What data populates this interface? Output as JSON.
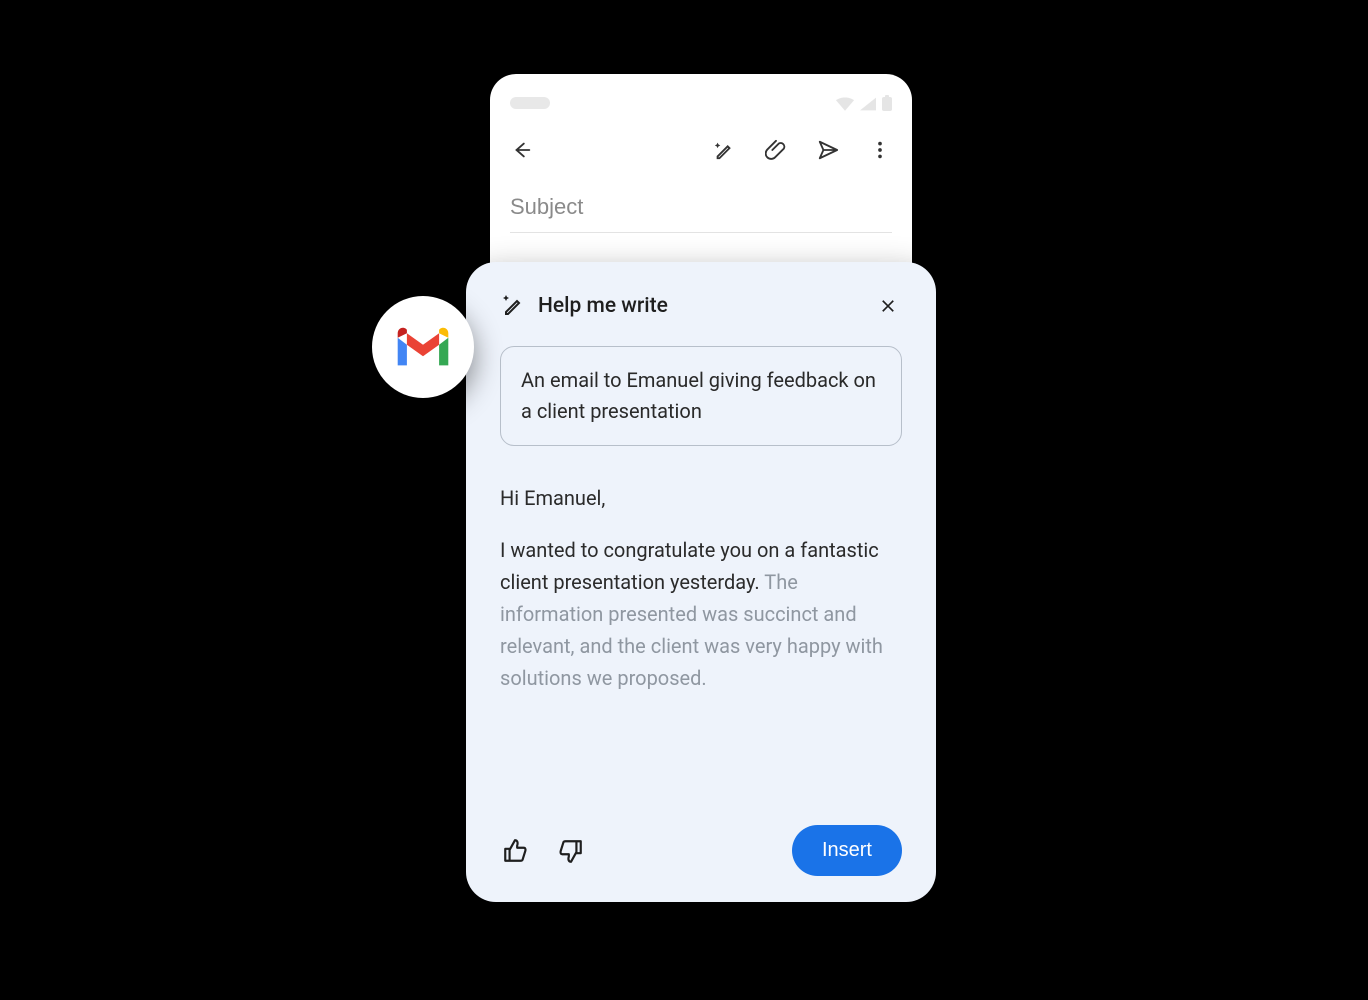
{
  "phone": {
    "subject_placeholder": "Subject"
  },
  "hmw": {
    "title": "Help me write",
    "prompt": "An email to Emanuel giving feedback on a client presentation",
    "draft_greeting": "Hi Emanuel,",
    "draft_p1": "I wanted to congratulate you on a fantastic client presentation yesterday. ",
    "draft_p2": "The information presented was succinct and relevant, and the client was very happy with solutions we proposed.",
    "insert_label": "Insert"
  },
  "badge": {
    "name": "Gmail"
  }
}
